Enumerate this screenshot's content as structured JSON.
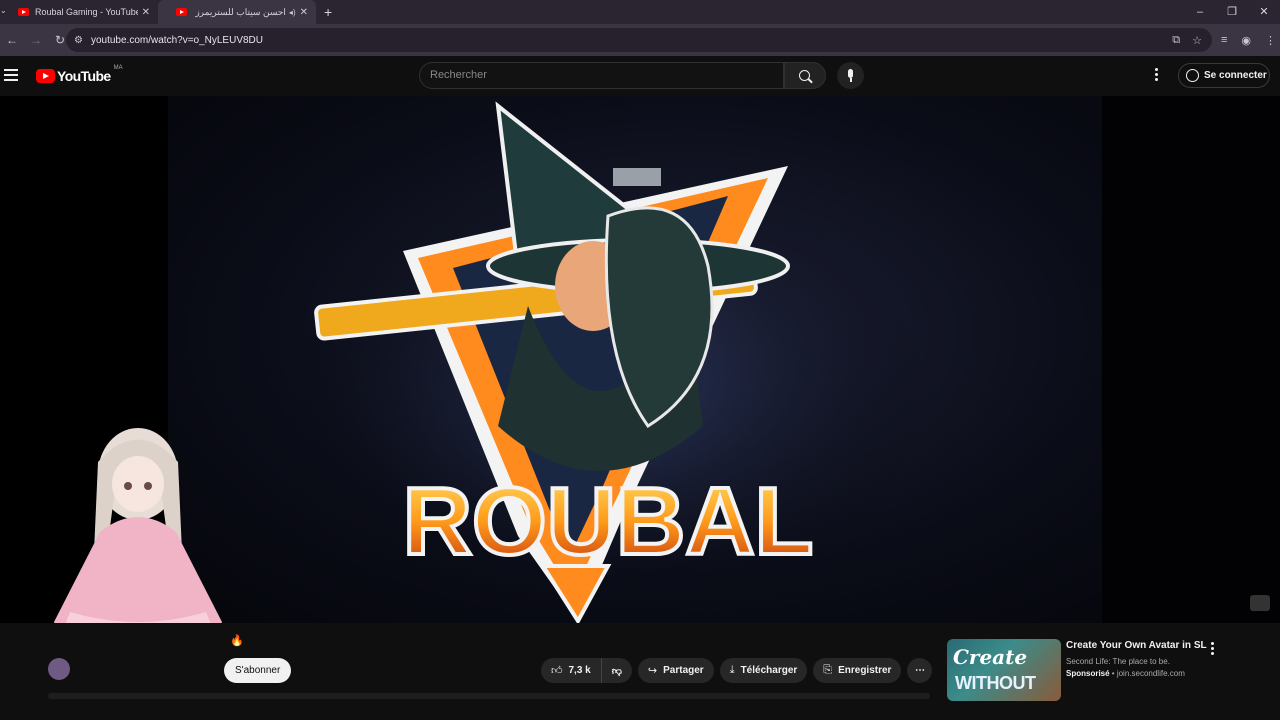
{
  "browser": {
    "tabs": [
      {
        "label": "Roubal Gaming - YouTube",
        "active": false
      },
      {
        "label": "احسن سيتاب للستريمرز في ال",
        "active": true
      }
    ],
    "new_tab_icon": "plus-icon",
    "url": "youtube.com/watch?v=o_NyLEUV8DU"
  },
  "youtube": {
    "logo_word": "YouTube",
    "country_code": "MA",
    "search_placeholder": "Rechercher",
    "signin_label": "Se connecter"
  },
  "video": {
    "thumbnail_text": "ROUBAL"
  },
  "below": {
    "subscribe_label": "S'abonner",
    "like_count": "7,3 k",
    "share_label": "Partager",
    "download_label": "Télécharger",
    "save_label": "Enregistrer"
  },
  "ad": {
    "title": "Create Your Own Avatar in SL",
    "subtitle": "Second Life: The place to be.",
    "sponsored_label": "Sponsorisé",
    "domain": "join.secondlife.com",
    "thumb_line1": "Create",
    "thumb_line2": "WITHOUT"
  },
  "colors": {
    "brand_red": "#ff0000",
    "page_bg": "#0f0f0f",
    "browser_frame": "#3b3443"
  }
}
